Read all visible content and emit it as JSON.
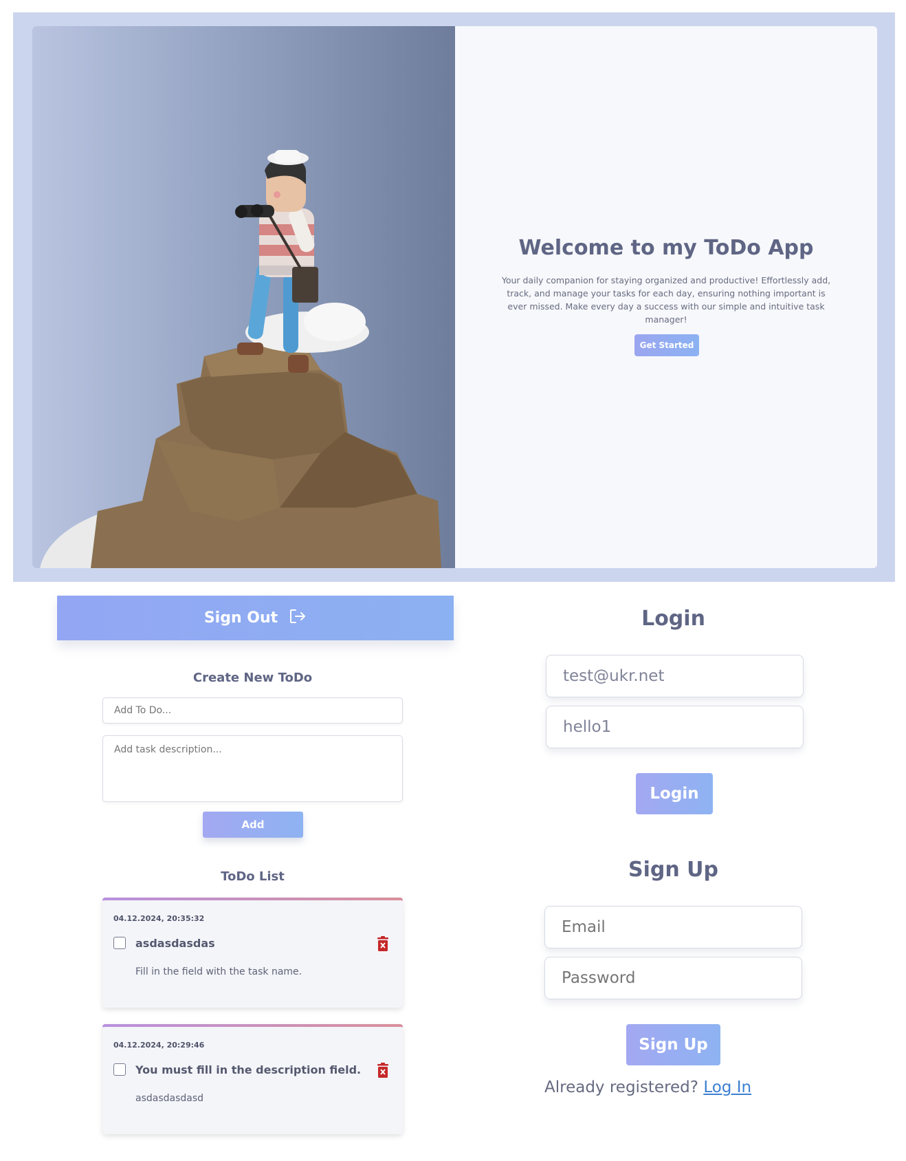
{
  "hero": {
    "title": "Welcome to my ToDo App",
    "description": "Your daily companion for staying organized and productive! Effortlessly add, track, and manage your tasks for each day, ensuring nothing important is ever missed. Make every day a success with our simple and intuitive task manager!",
    "cta_label": "Get Started"
  },
  "todo_panel": {
    "signout_label": "Sign Out",
    "create_title": "Create New ToDo",
    "title_placeholder": "Add To Do...",
    "desc_placeholder": "Add task description...",
    "add_label": "Add",
    "list_title": "ToDo List",
    "items": [
      {
        "date": "04.12.2024, 20:35:32",
        "title": "asdasdasdas",
        "description": "Fill in the field with the task name.",
        "done": false
      },
      {
        "date": "04.12.2024, 20:29:46",
        "title": "You must fill in the description field.",
        "description": "asdasdasdasd",
        "done": false
      }
    ]
  },
  "login": {
    "title": "Login",
    "email_value": "test@ukr.net",
    "password_value": "hello1",
    "button_label": "Login"
  },
  "signup": {
    "title": "Sign Up",
    "email_placeholder": "Email",
    "password_placeholder": "Password",
    "button_label": "Sign Up",
    "already_text": "Already registered?",
    "login_link": "Log In"
  },
  "colors": {
    "accent_gradient_start": "#93a6f3",
    "accent_gradient_end": "#8cb1f2",
    "delete_red": "#c62828",
    "link": "#3c7fd1"
  }
}
